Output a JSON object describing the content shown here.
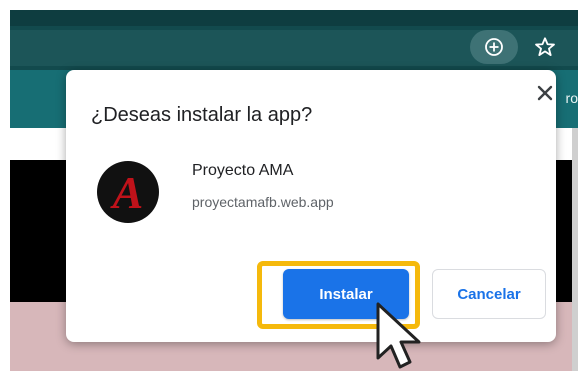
{
  "browser": {
    "toolbar": {
      "install_icon": "plus-circle-icon",
      "bookmark_icon": "star-icon"
    },
    "page_peek_text": "ro"
  },
  "dialog": {
    "title": "¿Deseas instalar la app?",
    "close_icon": "close-icon",
    "app": {
      "logo_letter": "A",
      "name": "Proyecto AMA",
      "url": "proyectamafb.web.app"
    },
    "buttons": {
      "install_label": "Instalar",
      "cancel_label": "Cancelar"
    }
  },
  "colors": {
    "primary_button": "#1a73e8",
    "highlight": "#f5b90c",
    "toolbar": "#124a4d",
    "app_bar": "#176e74",
    "logo_red": "#c0121a"
  }
}
